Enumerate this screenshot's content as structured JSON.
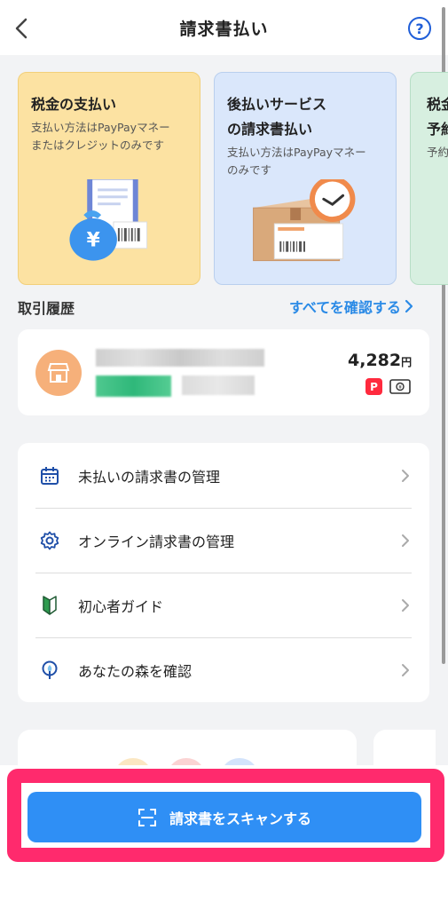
{
  "header": {
    "title": "請求書払い",
    "help_label": "?"
  },
  "cards": [
    {
      "title": "税金の支払い",
      "desc_line1": "支払い方法はPayPayマネー",
      "desc_line2": "またはクレジットのみです"
    },
    {
      "title_line1": "後払いサービス",
      "title_line2": "の請求書払い",
      "desc_line1": "支払い方法はPayPayマネー",
      "desc_line2": "のみです"
    },
    {
      "title_line1": "税金",
      "title_line2": "予約",
      "desc_line1": "予約"
    }
  ],
  "history": {
    "label": "取引履歴",
    "see_all": "すべてを確認する",
    "amount": "4,282",
    "currency": "円",
    "paypay_badge": "P"
  },
  "menu": {
    "items": [
      {
        "label": "未払いの請求書の管理",
        "icon": "calendar-icon"
      },
      {
        "label": "オンライン請求書の管理",
        "icon": "gear-icon"
      },
      {
        "label": "初心者ガイド",
        "icon": "beginner-mark-icon"
      },
      {
        "label": "あなたの森を確認",
        "icon": "tree-icon"
      }
    ]
  },
  "scan_button": {
    "label": "請求書をスキャンする"
  },
  "colors": {
    "accent_blue": "#2f8ff5",
    "link_blue": "#2a8ae6",
    "highlight_pink": "#ff2a6d",
    "tax_card_bg": "#fce2a2",
    "deferred_card_bg": "#dae7fb",
    "paypay_red": "#ff2a3e"
  }
}
